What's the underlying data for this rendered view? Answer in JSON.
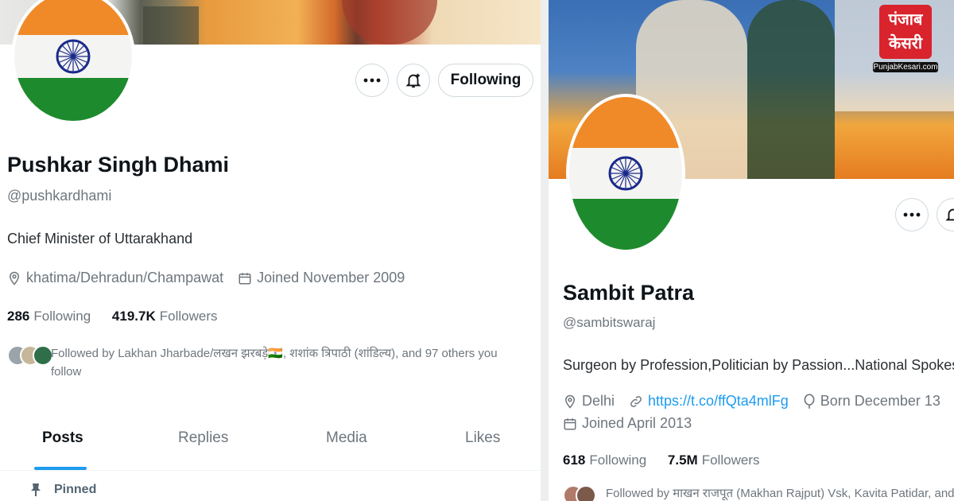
{
  "left_profile": {
    "name": "Pushkar Singh Dhami",
    "handle": "@pushkardhami",
    "bio": "Chief Minister of Uttarakhand",
    "location": "khatima/Dehradun/Champawat",
    "joined": "Joined November 2009",
    "following_count": "286",
    "following_label": "Following",
    "followers_count": "419.7K",
    "followers_label": "Followers",
    "followed_by_line1": "Followed by Lakhan Jharbade/लखन झरबड़े🇮🇳, शशांक त्रिपाठी (शांडिल्य), and 97 others you",
    "followed_by_line2": "follow",
    "follow_button": "Following",
    "tabs": [
      "Posts",
      "Replies",
      "Media",
      "Likes"
    ],
    "pinned_label": "Pinned"
  },
  "right_profile": {
    "name": "Sambit Patra",
    "handle": "@sambitswaraj",
    "bio": "Surgeon by Profession,Politician by Passion...National Spokespe",
    "location": "Delhi",
    "website": "https://t.co/ffQta4mlFg",
    "birthday": "Born December 13",
    "joined": "Joined April 2013",
    "following_count": "618",
    "following_label": "Following",
    "followers_count": "7.5M",
    "followers_label": "Followers",
    "followed_by": "Followed by माखन राजपूत (Makhan Rajput) Vsk, Kavita Patidar, and"
  },
  "watermark": {
    "brand_line1": "पंजाब",
    "brand_line2": "केसरी",
    "url": "PunjabKesari.com"
  },
  "colors": {
    "saffron": "#f08a28",
    "green": "#1e8a2e",
    "accent": "#1d9bf0",
    "brand_red": "#d9232d"
  },
  "icons": [
    "more-icon",
    "notification-bell-icon",
    "location-pin-icon",
    "calendar-icon",
    "link-icon",
    "balloon-icon",
    "pin-icon",
    "ashoka-chakra-icon"
  ]
}
